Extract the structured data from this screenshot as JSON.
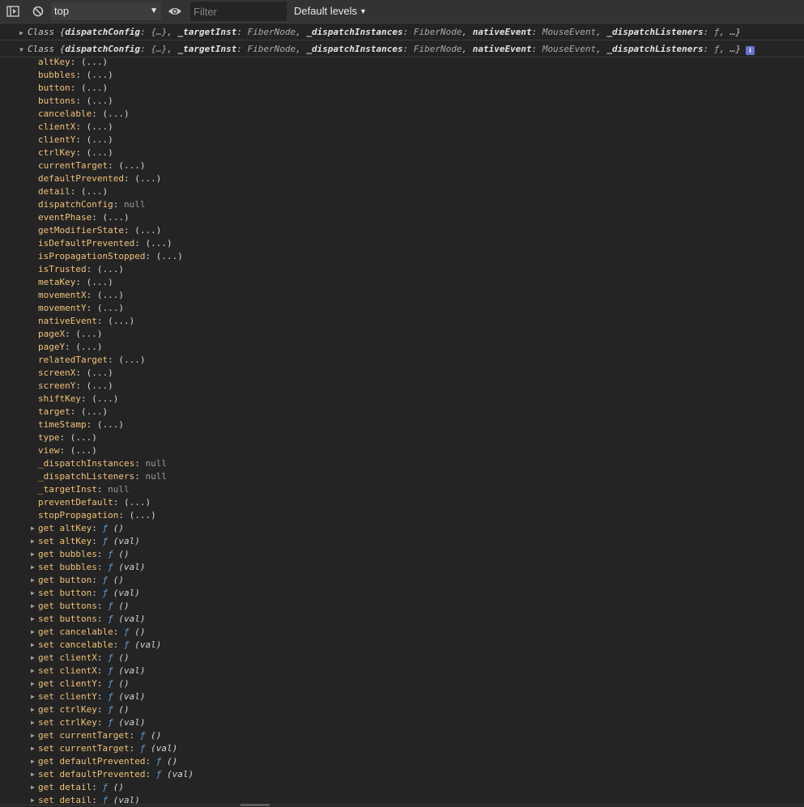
{
  "toolbar": {
    "sidebar_icon": "sidebar-toggle-icon",
    "clear_icon": "clear-console-icon",
    "context": "top",
    "context_caret": "▼",
    "eye_icon": "eye-icon",
    "filter_placeholder": "Filter",
    "levels": "Default levels",
    "levels_caret": "▼"
  },
  "entries": [
    {
      "expanded": false,
      "triangle": "▶",
      "class_name": "Class",
      "open_brace": " {",
      "pairs": [
        {
          "key": "dispatchConfig",
          "value": "{…}"
        },
        {
          "key": "_targetInst",
          "value": "FiberNode"
        },
        {
          "key": "_dispatchInstances",
          "value": "FiberNode"
        },
        {
          "key": "nativeEvent",
          "value": "MouseEvent"
        },
        {
          "key": "_dispatchListeners",
          "value": "ƒ"
        }
      ],
      "tail": ", …}"
    },
    {
      "expanded": true,
      "triangle": "▼",
      "class_name": "Class",
      "open_brace": " {",
      "pairs": [
        {
          "key": "dispatchConfig",
          "value": "{…}"
        },
        {
          "key": "_targetInst",
          "value": "FiberNode"
        },
        {
          "key": "_dispatchInstances",
          "value": "FiberNode"
        },
        {
          "key": "nativeEvent",
          "value": "MouseEvent"
        },
        {
          "key": "_dispatchListeners",
          "value": "ƒ"
        }
      ],
      "tail": ", …}",
      "info_badge": "i"
    }
  ],
  "properties": [
    {
      "key": "altKey",
      "value": "(...)",
      "kind": "lazy"
    },
    {
      "key": "bubbles",
      "value": "(...)",
      "kind": "lazy"
    },
    {
      "key": "button",
      "value": "(...)",
      "kind": "lazy"
    },
    {
      "key": "buttons",
      "value": "(...)",
      "kind": "lazy"
    },
    {
      "key": "cancelable",
      "value": "(...)",
      "kind": "lazy"
    },
    {
      "key": "clientX",
      "value": "(...)",
      "kind": "lazy"
    },
    {
      "key": "clientY",
      "value": "(...)",
      "kind": "lazy"
    },
    {
      "key": "ctrlKey",
      "value": "(...)",
      "kind": "lazy"
    },
    {
      "key": "currentTarget",
      "value": "(...)",
      "kind": "lazy"
    },
    {
      "key": "defaultPrevented",
      "value": "(...)",
      "kind": "lazy"
    },
    {
      "key": "detail",
      "value": "(...)",
      "kind": "lazy"
    },
    {
      "key": "dispatchConfig",
      "value": "null",
      "kind": "null"
    },
    {
      "key": "eventPhase",
      "value": "(...)",
      "kind": "lazy"
    },
    {
      "key": "getModifierState",
      "value": "(...)",
      "kind": "lazy"
    },
    {
      "key": "isDefaultPrevented",
      "value": "(...)",
      "kind": "lazy"
    },
    {
      "key": "isPropagationStopped",
      "value": "(...)",
      "kind": "lazy"
    },
    {
      "key": "isTrusted",
      "value": "(...)",
      "kind": "lazy"
    },
    {
      "key": "metaKey",
      "value": "(...)",
      "kind": "lazy"
    },
    {
      "key": "movementX",
      "value": "(...)",
      "kind": "lazy"
    },
    {
      "key": "movementY",
      "value": "(...)",
      "kind": "lazy"
    },
    {
      "key": "nativeEvent",
      "value": "(...)",
      "kind": "lazy"
    },
    {
      "key": "pageX",
      "value": "(...)",
      "kind": "lazy"
    },
    {
      "key": "pageY",
      "value": "(...)",
      "kind": "lazy"
    },
    {
      "key": "relatedTarget",
      "value": "(...)",
      "kind": "lazy"
    },
    {
      "key": "screenX",
      "value": "(...)",
      "kind": "lazy"
    },
    {
      "key": "screenY",
      "value": "(...)",
      "kind": "lazy"
    },
    {
      "key": "shiftKey",
      "value": "(...)",
      "kind": "lazy"
    },
    {
      "key": "target",
      "value": "(...)",
      "kind": "lazy"
    },
    {
      "key": "timeStamp",
      "value": "(...)",
      "kind": "lazy"
    },
    {
      "key": "type",
      "value": "(...)",
      "kind": "lazy"
    },
    {
      "key": "view",
      "value": "(...)",
      "kind": "lazy"
    },
    {
      "key": "_dispatchInstances",
      "value": "null",
      "kind": "null"
    },
    {
      "key": "_dispatchListeners",
      "value": "null",
      "kind": "null"
    },
    {
      "key": "_targetInst",
      "value": "null",
      "kind": "null"
    },
    {
      "key": "preventDefault",
      "value": "(...)",
      "kind": "lazy"
    },
    {
      "key": "stopPropagation",
      "value": "(...)",
      "kind": "lazy"
    },
    {
      "key": "get altKey",
      "value": "ƒ",
      "args": "()",
      "kind": "accessor"
    },
    {
      "key": "set altKey",
      "value": "ƒ",
      "args": "(val)",
      "kind": "accessor"
    },
    {
      "key": "get bubbles",
      "value": "ƒ",
      "args": "()",
      "kind": "accessor"
    },
    {
      "key": "set bubbles",
      "value": "ƒ",
      "args": "(val)",
      "kind": "accessor"
    },
    {
      "key": "get button",
      "value": "ƒ",
      "args": "()",
      "kind": "accessor"
    },
    {
      "key": "set button",
      "value": "ƒ",
      "args": "(val)",
      "kind": "accessor"
    },
    {
      "key": "get buttons",
      "value": "ƒ",
      "args": "()",
      "kind": "accessor"
    },
    {
      "key": "set buttons",
      "value": "ƒ",
      "args": "(val)",
      "kind": "accessor"
    },
    {
      "key": "get cancelable",
      "value": "ƒ",
      "args": "()",
      "kind": "accessor"
    },
    {
      "key": "set cancelable",
      "value": "ƒ",
      "args": "(val)",
      "kind": "accessor"
    },
    {
      "key": "get clientX",
      "value": "ƒ",
      "args": "()",
      "kind": "accessor"
    },
    {
      "key": "set clientX",
      "value": "ƒ",
      "args": "(val)",
      "kind": "accessor"
    },
    {
      "key": "get clientY",
      "value": "ƒ",
      "args": "()",
      "kind": "accessor"
    },
    {
      "key": "set clientY",
      "value": "ƒ",
      "args": "(val)",
      "kind": "accessor"
    },
    {
      "key": "get ctrlKey",
      "value": "ƒ",
      "args": "()",
      "kind": "accessor"
    },
    {
      "key": "set ctrlKey",
      "value": "ƒ",
      "args": "(val)",
      "kind": "accessor"
    },
    {
      "key": "get currentTarget",
      "value": "ƒ",
      "args": "()",
      "kind": "accessor"
    },
    {
      "key": "set currentTarget",
      "value": "ƒ",
      "args": "(val)",
      "kind": "accessor"
    },
    {
      "key": "get defaultPrevented",
      "value": "ƒ",
      "args": "()",
      "kind": "accessor"
    },
    {
      "key": "set defaultPrevented",
      "value": "ƒ",
      "args": "(val)",
      "kind": "accessor"
    },
    {
      "key": "get detail",
      "value": "ƒ",
      "args": "()",
      "kind": "accessor"
    },
    {
      "key": "set detail",
      "value": "ƒ",
      "args": "(val)",
      "kind": "accessor"
    }
  ],
  "colors": {
    "background": "#242424",
    "toolbar": "#333333",
    "property_key": "#f0c278",
    "function_marker": "#5c9eda",
    "info_badge": "#6673cc"
  }
}
